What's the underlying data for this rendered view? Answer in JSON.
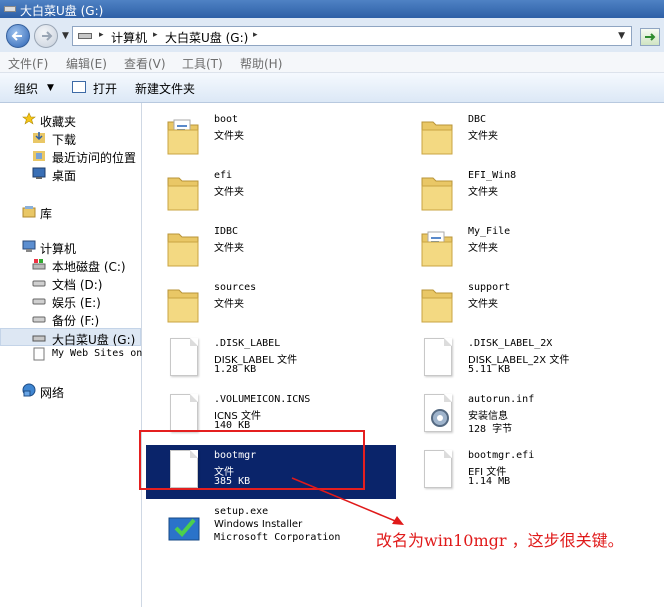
{
  "window": {
    "title": "大白菜U盘 (G:)"
  },
  "address": {
    "segments": [
      "计算机",
      "大白菜U盘 (G:)"
    ]
  },
  "menu": [
    "文件(F)",
    "编辑(E)",
    "查看(V)",
    "工具(T)",
    "帮助(H)"
  ],
  "toolbar": {
    "organize": "组织",
    "open": "打开",
    "new_folder": "新建文件夹"
  },
  "sidebar": {
    "favorites": "收藏夹",
    "downloads": "下载",
    "recent": "最近访问的位置",
    "desktop": "桌面",
    "libraries": "库",
    "computer": "计算机",
    "local_disk": "本地磁盘 (C:)",
    "docs": "文档 (D:)",
    "ent": "娱乐 (E:)",
    "backup": "备份 (F:)",
    "usb": "大白菜U盘 (G:)",
    "websites": "My Web Sites on MSN",
    "network": "网络"
  },
  "files": [
    {
      "name": "boot",
      "type": "文件夹",
      "size": "",
      "icon": "folder-docs-icon"
    },
    {
      "name": "DBC",
      "type": "文件夹",
      "size": "",
      "icon": "folder-icon"
    },
    {
      "name": "efi",
      "type": "文件夹",
      "size": "",
      "icon": "folder-icon"
    },
    {
      "name": "EFI_Win8",
      "type": "文件夹",
      "size": "",
      "icon": "folder-icon"
    },
    {
      "name": "IDBC",
      "type": "文件夹",
      "size": "",
      "icon": "folder-icon"
    },
    {
      "name": "My_File",
      "type": "文件夹",
      "size": "",
      "icon": "folder-docs-icon"
    },
    {
      "name": "sources",
      "type": "文件夹",
      "size": "",
      "icon": "folder-icon"
    },
    {
      "name": "support",
      "type": "文件夹",
      "size": "",
      "icon": "folder-icon"
    },
    {
      "name": ".DISK_LABEL",
      "type": "DISK_LABEL 文件",
      "size": "1.28 KB",
      "icon": "file-icon"
    },
    {
      "name": ".DISK_LABEL_2X",
      "type": "DISK_LABEL_2X 文件",
      "size": "5.11 KB",
      "icon": "file-icon"
    },
    {
      "name": ".VOLUMEICON.ICNS",
      "type": "ICNS 文件",
      "size": "140 KB",
      "icon": "file-icon"
    },
    {
      "name": "autorun.inf",
      "type": "安装信息",
      "size": "128 字节",
      "icon": "settings-file-icon"
    },
    {
      "name": "bootmgr",
      "type": "文件",
      "size": "385 KB",
      "icon": "file-icon"
    },
    {
      "name": "bootmgr.efi",
      "type": "EFI 文件",
      "size": "1.14 MB",
      "icon": "file-icon"
    },
    {
      "name": "setup.exe",
      "type": "Windows Installer",
      "size": "Microsoft Corporation",
      "icon": "installer-icon"
    }
  ],
  "annotation": "改名为win10mgr ，这步很关键。",
  "colors": {
    "selection": "#0a246a",
    "annotation": "#e01a1a",
    "folder": "#e9c766"
  }
}
